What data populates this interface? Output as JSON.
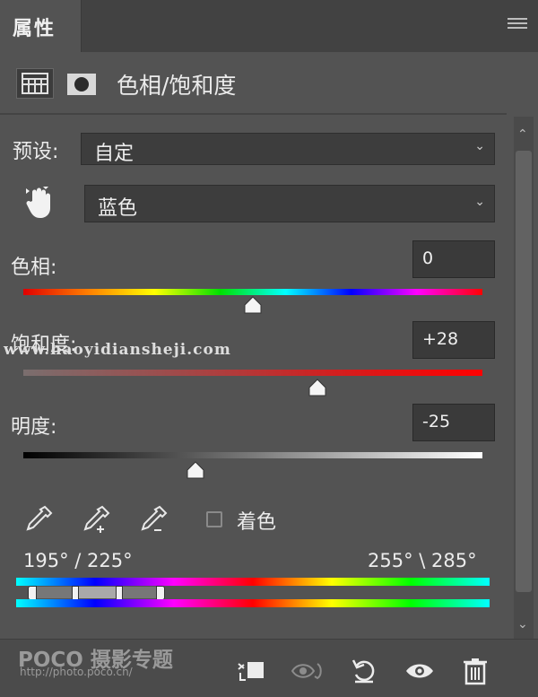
{
  "panel": {
    "tab_label": "属性",
    "title": "色相/饱和度"
  },
  "preset": {
    "label": "预设:",
    "value": "自定"
  },
  "channel": {
    "value": "蓝色"
  },
  "hue": {
    "label": "色相:",
    "value": "0",
    "level_fraction": 0.5
  },
  "saturation": {
    "label": "饱和度:",
    "value": "+28",
    "level_fraction": 0.64
  },
  "lightness": {
    "label": "明度:",
    "value": "-25",
    "level_fraction": 0.375
  },
  "colorize": {
    "label": "着色",
    "checked": false
  },
  "range": {
    "left_text": "195° / 225°",
    "right_text": "255° \\ 285°"
  },
  "watermarks": {
    "url_text": "www.haoyidiansheji.com",
    "poco_text": "POCO 摄影专题",
    "poco_url": "http://photo.poco.cn/"
  },
  "colors": {
    "panel_bg": "#535353",
    "tab_bg": "#424242",
    "input_bg": "#3d3d3d"
  },
  "icons": [
    "adjustment-grid-icon",
    "mask-icon",
    "targeted-adjust-hand-icon",
    "eyedropper-icon",
    "eyedropper-add-icon",
    "eyedropper-subtract-icon",
    "clip-to-layer-icon",
    "view-previous-icon",
    "reset-icon",
    "visibility-eye-icon",
    "trash-icon",
    "panel-menu-icon"
  ]
}
